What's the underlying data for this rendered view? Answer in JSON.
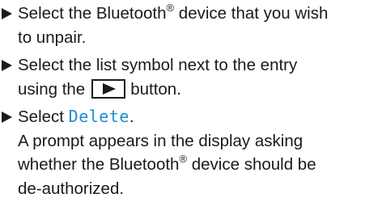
{
  "steps": [
    {
      "text_before": "Select the Bluetooth",
      "superscript": "®",
      "text_after": " device that you wish",
      "line2": "to unpair."
    },
    {
      "line1": "Select the list symbol next to the entry",
      "line2_before": "using the",
      "button_icon": "play-triangle-icon",
      "line2_after": "button."
    },
    {
      "text_before": "Select ",
      "menu_term": "Delete",
      "text_after": ".",
      "result_line1": "A prompt appears in the display asking",
      "result_line2_before": "whether the Bluetooth",
      "result_superscript": "®",
      "result_line2_after": " device should be",
      "result_line3": "de-authorized."
    }
  ],
  "colors": {
    "text": "#1a1a1a",
    "menu_term": "#1a8fd0"
  },
  "bullet_icon": "right-triangle-bullet-icon"
}
